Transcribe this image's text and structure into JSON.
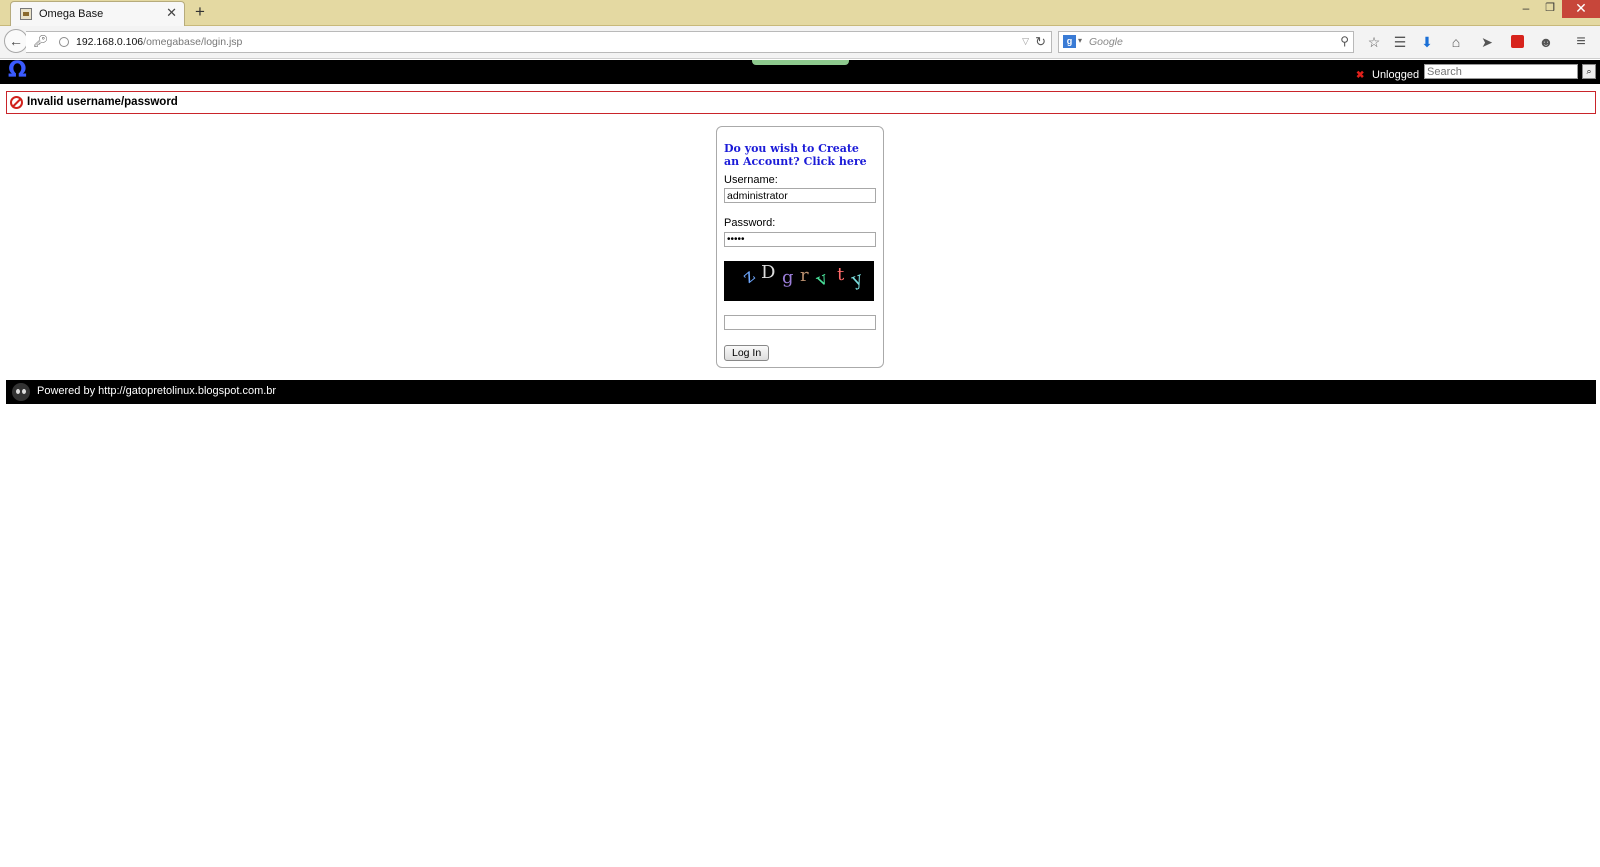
{
  "browser": {
    "tab_title": "Omega Base",
    "tab_close": "✕",
    "new_tab": "+",
    "url_host": "192.168.0.106",
    "url_path": "/omegabase/login.jsp",
    "search_engine_letter": "g",
    "search_placeholder": "Google",
    "window_min": "‒",
    "window_max": "❐",
    "window_close": "✕"
  },
  "site_header": {
    "logo": "Ω",
    "status": "Unlogged",
    "search_placeholder": "Search"
  },
  "error": {
    "message": "Invalid username/password"
  },
  "login": {
    "create_account": "Do you wish to Create an Account? Click here",
    "username_label": "Username:",
    "username_value": "administrator",
    "password_label": "Password:",
    "password_value": "•••••",
    "captcha_chars": [
      "z",
      "D",
      "g",
      "r",
      "v",
      "t",
      "y"
    ],
    "captcha_value": "",
    "login_button": "Log In"
  },
  "footer": {
    "text": "Powered by http://gatopretolinux.blogspot.com.br"
  }
}
